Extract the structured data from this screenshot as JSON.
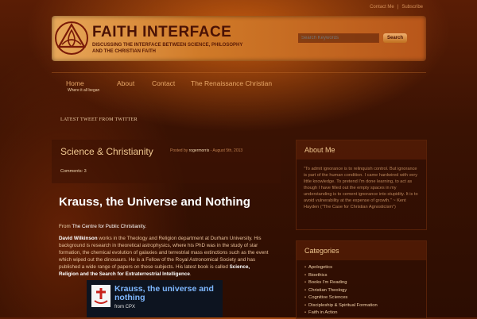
{
  "top_links": [
    "Contact Me",
    "Subscribe"
  ],
  "top_link_separator": "|",
  "header": {
    "title": "FAITH INTERFACE",
    "tagline": "Discussing the Interface between Science, Philosophy and the Christian Faith",
    "search_placeholder": "Search Keywords",
    "search_button": "Search"
  },
  "nav": {
    "items": [
      {
        "label": "Home",
        "sub": "Where it all began"
      },
      {
        "label": "About"
      },
      {
        "label": "Contact"
      },
      {
        "label": "The Renaissance Christian"
      }
    ]
  },
  "tweet_heading": "Latest Tweet from Twitter",
  "post": {
    "category": "Science & Christianity",
    "posted_by_label": "Posted by",
    "author": "rogermorris",
    "date": "- August 5th, 2013",
    "comments": "Comments: 3",
    "title": "Krauss, the Universe and Nothing",
    "source_prefix": "From",
    "source_link": "The Centre for Public Christianity.",
    "body_name": "David Wilkinson",
    "body_text": "works in the Theology and Religion department at Durham University. His background is research in theoretical astrophysics, where his PhD was in the study of star formation, the chemical evolution of galaxies and terrestrial mass extinctions such as the event which wiped out the dinosaurs. He is a Fellow of the Royal Astronomical Society and has published a wide range of papers on these subjects. His latest book is called",
    "book_title": "Science, Religion and the Search for Extraterrestrial Intelligence",
    "body_end": ".",
    "video_title": "Krauss, the universe and nothing",
    "video_from": "from CPX"
  },
  "sidebar": {
    "about_title": "About Me",
    "about_text": "\"To admit ignorance is to relinquish control. But ignorance is part of the human condition. I came hardwired with very little knowledge. To pretend I'm done learning, to act as though I have filled out the empty spaces in my understanding is to cement ignorance into stupidity. It is to avoid vulnerability at the expense of growth.\" ~ Kent Hayden (\"The Case for Christian Agnosticism\")",
    "categories_title": "Categories",
    "categories": [
      "Apologetics",
      "Bioethics",
      "Books I'm Reading",
      "Christian Theology",
      "Cognitive Sciences",
      "Discipleship & Spiritual Formation",
      "Faith in Action"
    ]
  }
}
